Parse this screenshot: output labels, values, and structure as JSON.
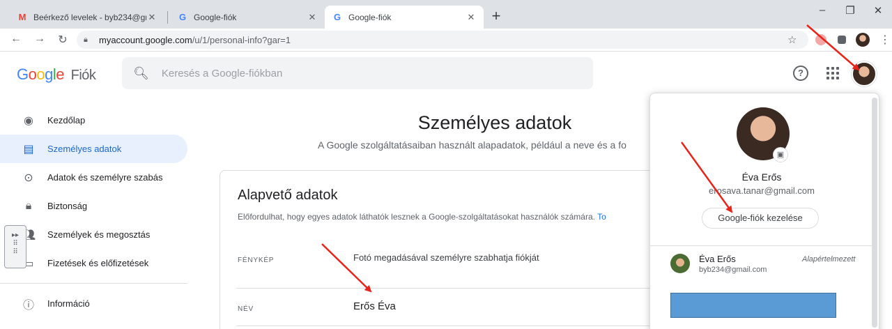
{
  "browser": {
    "tabs": [
      {
        "title": "Beérkező levelek - byb234@gma",
        "favicon": "gmail-icon"
      },
      {
        "title": "Google-fiók",
        "favicon": "google-icon"
      },
      {
        "title": "Google-fiók",
        "favicon": "google-icon"
      }
    ],
    "new_tab": "+",
    "url_host": "myaccount.google.com",
    "url_path": "/u/1/personal-info?gar=1"
  },
  "header": {
    "logo_google": "Google",
    "logo_product": "Fiók",
    "search_placeholder": "Keresés a Google-fiókban",
    "help": "?"
  },
  "sidebar": {
    "items": [
      {
        "label": "Kezdőlap",
        "icon": "account-circle-icon"
      },
      {
        "label": "Személyes adatok",
        "icon": "id-card-icon"
      },
      {
        "label": "Adatok és személyre szabás",
        "icon": "toggle-icon"
      },
      {
        "label": "Biztonság",
        "icon": "lock-icon"
      },
      {
        "label": "Személyek és megosztás",
        "icon": "people-icon"
      },
      {
        "label": "Fizetések és előfizetések",
        "icon": "credit-card-icon"
      },
      {
        "label": "Információ",
        "icon": "info-icon"
      }
    ]
  },
  "main": {
    "title": "Személyes adatok",
    "subtitle": "A Google szolgáltatásaiban használt alapadatok, például a neve és a fo",
    "card": {
      "title": "Alapvető adatok",
      "description": "Előfordulhat, hogy egyes adatok láthatók lesznek a Google-szolgáltatásokat használók számára.",
      "description_link": "To",
      "rows": [
        {
          "label": "FÉNYKÉP",
          "value": "Fotó megadásával személyre szabhatja fiókját"
        },
        {
          "label": "NÉV",
          "value": "Erős Éva"
        }
      ]
    }
  },
  "popup": {
    "name": "Éva Erős",
    "email": "erosava.tanar@gmail.com",
    "manage_button": "Google-fiók kezelése",
    "other_account": {
      "name": "Éva Erős",
      "email": "byb234@gmail.com",
      "badge": "Alapértelmezett"
    }
  },
  "colors": {
    "accent": "#1967d2",
    "active_bg": "#e8f0fe",
    "annotation_arrow": "#e8231a",
    "blue_box": "#5b9bd5"
  }
}
